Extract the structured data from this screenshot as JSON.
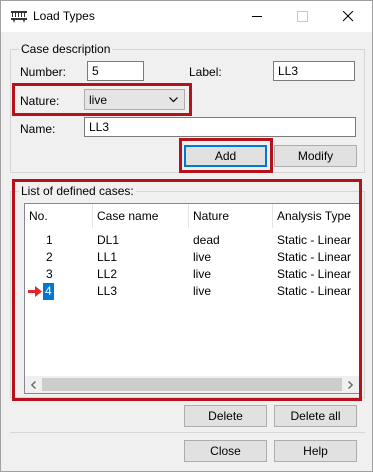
{
  "window": {
    "title": "Load Types"
  },
  "case_description": {
    "group_label": "Case description",
    "number_label": "Number:",
    "number_value": "5",
    "label_label": "Label:",
    "label_value": "LL3",
    "nature_label": "Nature:",
    "nature_value": "live",
    "name_label": "Name:",
    "name_value": "LL3",
    "add_button": "Add",
    "modify_button": "Modify"
  },
  "defined_cases": {
    "group_label": "List of defined cases:",
    "columns": [
      "No.",
      "Case name",
      "Nature",
      "Analysis Type"
    ],
    "rows": [
      {
        "no": "1",
        "case_name": "DL1",
        "nature": "dead",
        "analysis_type": "Static - Linear"
      },
      {
        "no": "2",
        "case_name": "LL1",
        "nature": "live",
        "analysis_type": "Static - Linear"
      },
      {
        "no": "3",
        "case_name": "LL2",
        "nature": "live",
        "analysis_type": "Static - Linear"
      },
      {
        "no": "4",
        "case_name": "LL3",
        "nature": "live",
        "analysis_type": "Static - Linear"
      }
    ],
    "selected_row": 3,
    "delete_button": "Delete",
    "delete_all_button": "Delete all"
  },
  "footer": {
    "close_button": "Close",
    "help_button": "Help"
  },
  "colors": {
    "highlight": "#b5121b",
    "selection": "#0078d7",
    "arrow": "#e3262a"
  },
  "icons": [
    "load-types-app-icon",
    "minimize-icon",
    "maximize-icon",
    "close-icon",
    "chevron-down-icon",
    "red-arrow-icon",
    "scroll-left-icon",
    "scroll-right-icon"
  ]
}
